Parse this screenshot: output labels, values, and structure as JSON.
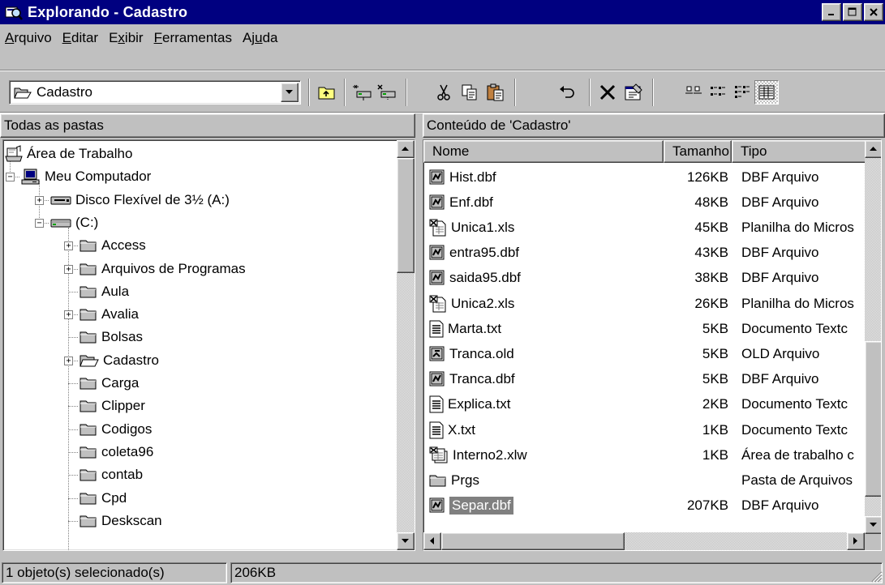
{
  "window": {
    "title": "Explorando - Cadastro"
  },
  "menu": [
    {
      "pre": "",
      "u": "A",
      "post": "rquivo"
    },
    {
      "pre": "",
      "u": "E",
      "post": "ditar"
    },
    {
      "pre": "E",
      "u": "x",
      "post": "ibir"
    },
    {
      "pre": "",
      "u": "F",
      "post": "erramentas"
    },
    {
      "pre": "Aj",
      "u": "u",
      "post": "da"
    }
  ],
  "address": {
    "value": "Cadastro"
  },
  "panes": {
    "left_header": "Todas as pastas",
    "right_header": "Conteúdo de 'Cadastro'"
  },
  "tree": [
    {
      "label": "Área de Trabalho",
      "icon": "desktop-icon",
      "level": 0,
      "expander": ""
    },
    {
      "label": "Meu Computador",
      "icon": "computer-icon",
      "level": 1,
      "expander": "-"
    },
    {
      "label": "Disco Flexível de 3½ (A:)",
      "icon": "floppy-drive-icon",
      "level": 2,
      "expander": "+"
    },
    {
      "label": "(C:)",
      "icon": "hard-drive-icon",
      "level": 2,
      "expander": "-"
    },
    {
      "label": "Access",
      "icon": "folder-icon",
      "level": 3,
      "expander": "+"
    },
    {
      "label": "Arquivos de Programas",
      "icon": "folder-icon",
      "level": 3,
      "expander": "+"
    },
    {
      "label": "Aula",
      "icon": "folder-icon",
      "level": 3,
      "expander": ""
    },
    {
      "label": "Avalia",
      "icon": "folder-icon",
      "level": 3,
      "expander": "+"
    },
    {
      "label": "Bolsas",
      "icon": "folder-icon",
      "level": 3,
      "expander": ""
    },
    {
      "label": "Cadastro",
      "icon": "open-folder-icon",
      "level": 3,
      "expander": "+"
    },
    {
      "label": "Carga",
      "icon": "folder-icon",
      "level": 3,
      "expander": ""
    },
    {
      "label": "Clipper",
      "icon": "folder-icon",
      "level": 3,
      "expander": ""
    },
    {
      "label": "Codigos",
      "icon": "folder-icon",
      "level": 3,
      "expander": ""
    },
    {
      "label": "coleta96",
      "icon": "folder-icon",
      "level": 3,
      "expander": ""
    },
    {
      "label": "contab",
      "icon": "folder-icon",
      "level": 3,
      "expander": ""
    },
    {
      "label": "Cpd",
      "icon": "folder-icon",
      "level": 3,
      "expander": ""
    },
    {
      "label": "Deskscan",
      "icon": "folder-icon",
      "level": 3,
      "expander": ""
    }
  ],
  "list": {
    "columns": [
      "Nome",
      "Tamanho",
      "Tipo"
    ],
    "rows": [
      {
        "name": "Hist.dbf",
        "size": "126KB",
        "type": "DBF Arquivo",
        "icon": "dbf-file-icon"
      },
      {
        "name": "Enf.dbf",
        "size": "48KB",
        "type": "DBF Arquivo",
        "icon": "dbf-file-icon"
      },
      {
        "name": "Unica1.xls",
        "size": "45KB",
        "type": "Planilha do Micros",
        "icon": "excel-file-icon"
      },
      {
        "name": "entra95.dbf",
        "size": "43KB",
        "type": "DBF Arquivo",
        "icon": "dbf-file-icon"
      },
      {
        "name": "saida95.dbf",
        "size": "38KB",
        "type": "DBF Arquivo",
        "icon": "dbf-file-icon"
      },
      {
        "name": "Unica2.xls",
        "size": "26KB",
        "type": "Planilha do Micros",
        "icon": "excel-file-icon"
      },
      {
        "name": "Marta.txt",
        "size": "5KB",
        "type": "Documento Textc",
        "icon": "text-file-icon"
      },
      {
        "name": "Tranca.old",
        "size": "5KB",
        "type": "OLD Arquivo",
        "icon": "old-file-icon"
      },
      {
        "name": "Tranca.dbf",
        "size": "5KB",
        "type": "DBF Arquivo",
        "icon": "dbf-file-icon"
      },
      {
        "name": "Explica.txt",
        "size": "2KB",
        "type": "Documento Textc",
        "icon": "text-file-icon"
      },
      {
        "name": "X.txt",
        "size": "1KB",
        "type": "Documento Textc",
        "icon": "text-file-icon"
      },
      {
        "name": "Interno2.xlw",
        "size": "1KB",
        "type": "Área de trabalho c",
        "icon": "excel-workspace-icon"
      },
      {
        "name": "Prgs",
        "size": "",
        "type": "Pasta de Arquivos",
        "icon": "folder-icon"
      },
      {
        "name": "Separ.dbf",
        "size": "207KB",
        "type": "DBF Arquivo",
        "icon": "dbf-file-icon",
        "selected": true
      }
    ]
  },
  "status": {
    "selection": "1 objeto(s) selecionado(s)",
    "size": "206KB"
  },
  "colors": {
    "titlebar": "#000080",
    "face": "#c0c0c0",
    "selection": "#808080"
  }
}
